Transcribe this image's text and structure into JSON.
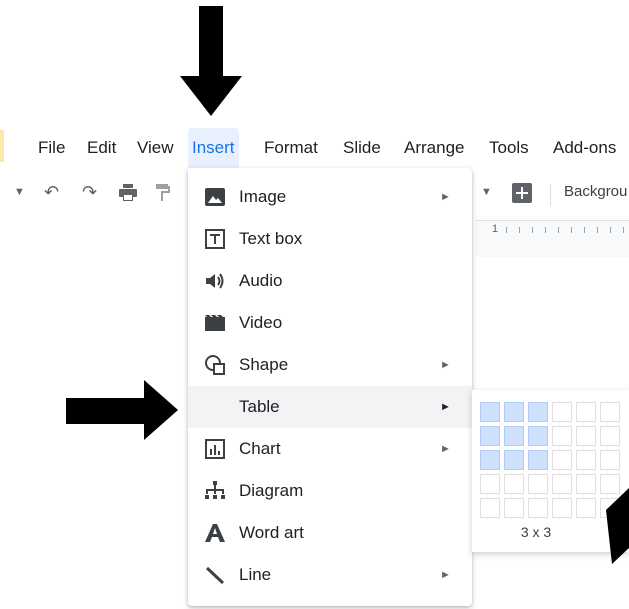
{
  "menubar": {
    "items": [
      "File",
      "Edit",
      "View",
      "Insert",
      "Format",
      "Slide",
      "Arrange",
      "Tools",
      "Add-ons"
    ]
  },
  "toolbar": {
    "background_label": "Backgrou",
    "ruler_number": "1"
  },
  "insert_menu": {
    "items": [
      {
        "label": "Image",
        "icon": "image-icon",
        "submenu": true
      },
      {
        "label": "Text box",
        "icon": "text-box-icon",
        "submenu": false
      },
      {
        "label": "Audio",
        "icon": "audio-icon",
        "submenu": false
      },
      {
        "label": "Video",
        "icon": "video-icon",
        "submenu": false
      },
      {
        "label": "Shape",
        "icon": "shape-icon",
        "submenu": true
      },
      {
        "label": "Table",
        "icon": "",
        "submenu": true
      },
      {
        "label": "Chart",
        "icon": "chart-icon",
        "submenu": true
      },
      {
        "label": "Diagram",
        "icon": "diagram-icon",
        "submenu": false
      },
      {
        "label": "Word art",
        "icon": "word-art-icon",
        "submenu": false
      },
      {
        "label": "Line",
        "icon": "line-icon",
        "submenu": true
      }
    ]
  },
  "table_picker": {
    "size_label": "3 x 3",
    "selected_rows": 3,
    "selected_cols": 3
  },
  "colors": {
    "accent": "#1a73e8",
    "highlight": "#e8f0fe",
    "selected_cell": "#cfe0fc"
  }
}
